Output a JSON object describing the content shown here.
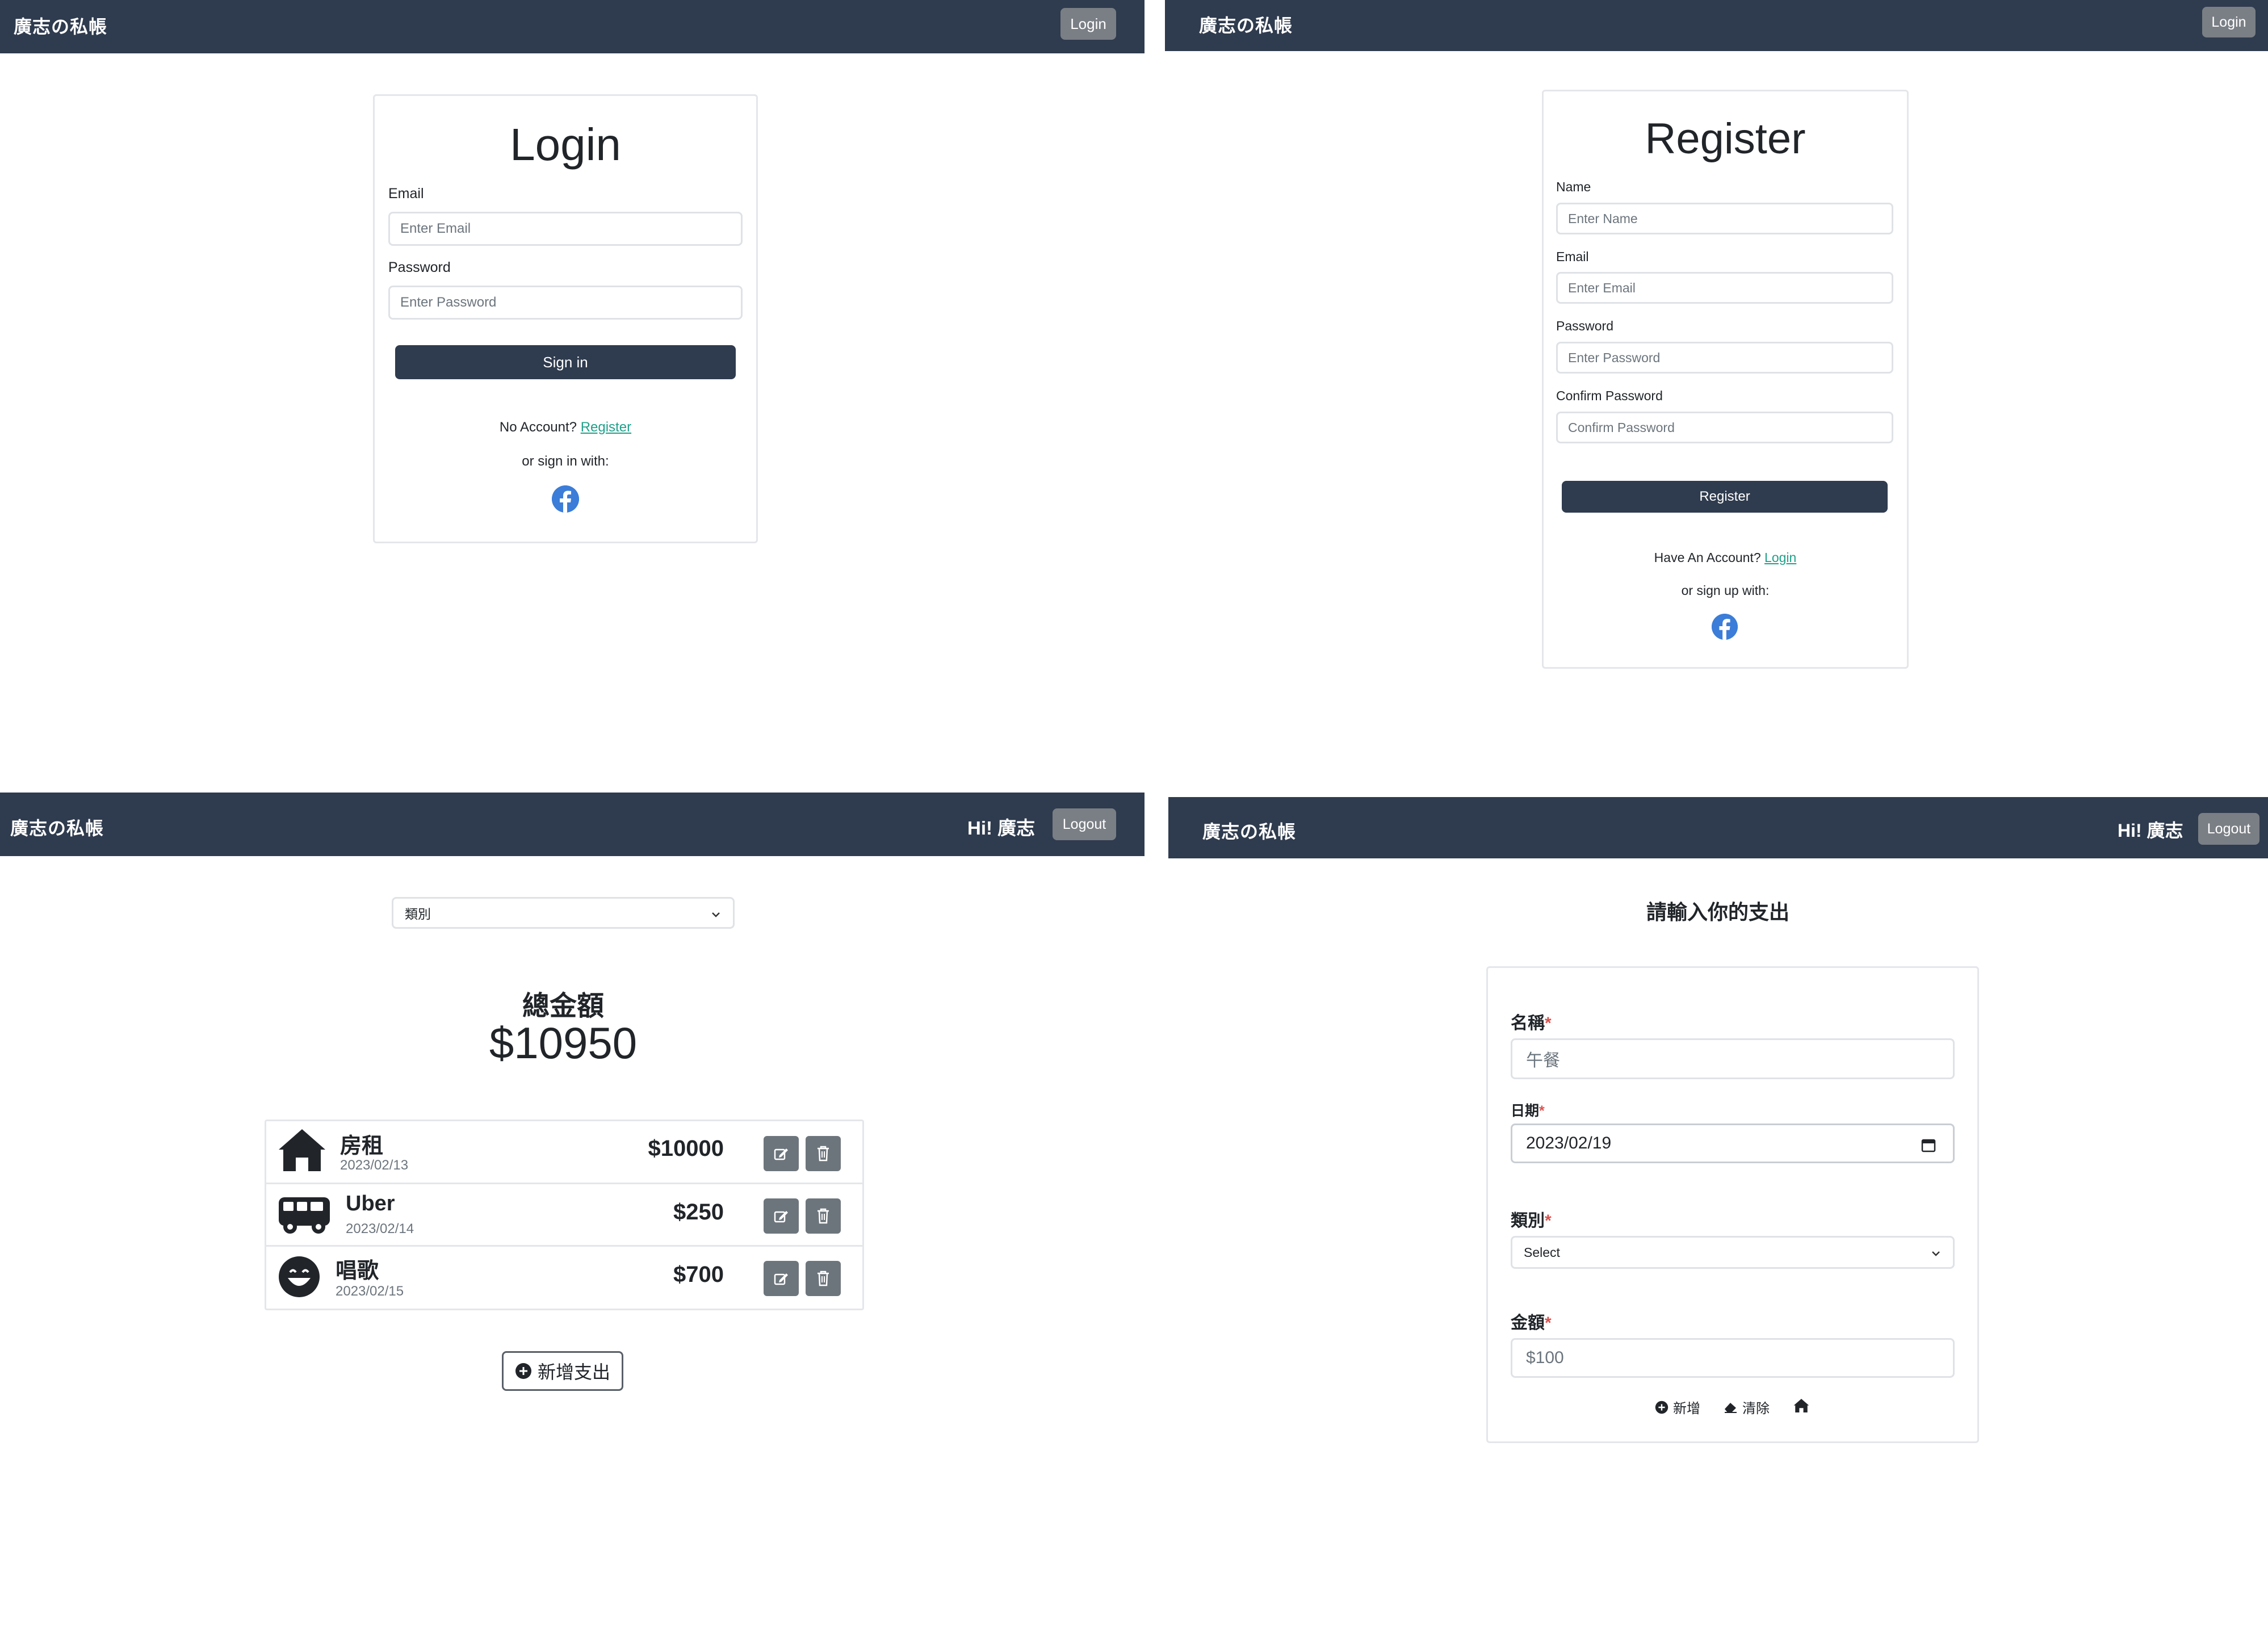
{
  "brand": "廣志の私帳",
  "login_page": {
    "nav_button": "Login",
    "title": "Login",
    "email_label": "Email",
    "email_placeholder": "Enter Email",
    "password_label": "Password",
    "password_placeholder": "Enter Password",
    "submit_label": "Sign in",
    "no_account_text": "No Account?",
    "register_link": "Register",
    "social_text": "or sign in with:",
    "social_icon": "facebook-icon"
  },
  "register_page": {
    "nav_button": "Login",
    "title": "Register",
    "name_label": "Name",
    "name_placeholder": "Enter Name",
    "email_label": "Email",
    "email_placeholder": "Enter Email",
    "password_label": "Password",
    "password_placeholder": "Enter Password",
    "confirm_label": "Confirm Password",
    "confirm_placeholder": "Confirm Password",
    "submit_label": "Register",
    "have_account_text": "Have An Account?",
    "login_link": "Login",
    "social_text": "or sign up with:",
    "social_icon": "facebook-icon"
  },
  "list_page": {
    "greeting_prefix": "Hi!",
    "user_name": "廣志",
    "logout_label": "Logout",
    "category_select": "類別",
    "total_label": "總金額",
    "total_amount": "$10950",
    "records": [
      {
        "icon": "home-icon",
        "name": "房租",
        "date": "2023/02/13",
        "amount": "$10000"
      },
      {
        "icon": "van-icon",
        "name": "Uber",
        "date": "2023/02/14",
        "amount": "$250"
      },
      {
        "icon": "smile-icon",
        "name": "唱歌",
        "date": "2023/02/15",
        "amount": "$700"
      }
    ],
    "add_button": "新增支出"
  },
  "form_page": {
    "greeting_prefix": "Hi!",
    "user_name": "廣志",
    "logout_label": "Logout",
    "heading": "請輸入你的支出",
    "name_label": "名稱",
    "name_placeholder": "午餐",
    "date_label": "日期",
    "date_value": "2023/02/19",
    "category_label": "類別",
    "category_value": "Select",
    "amount_label": "金額",
    "amount_placeholder": "$100",
    "add_label": "新增",
    "clear_label": "清除",
    "required_mark": "*"
  },
  "colors": {
    "navbar": "#2f3b4e",
    "nav_button": "#7a7f85",
    "link": "#20a08a",
    "facebook": "#3b7dd8",
    "required": "#d9534f"
  }
}
